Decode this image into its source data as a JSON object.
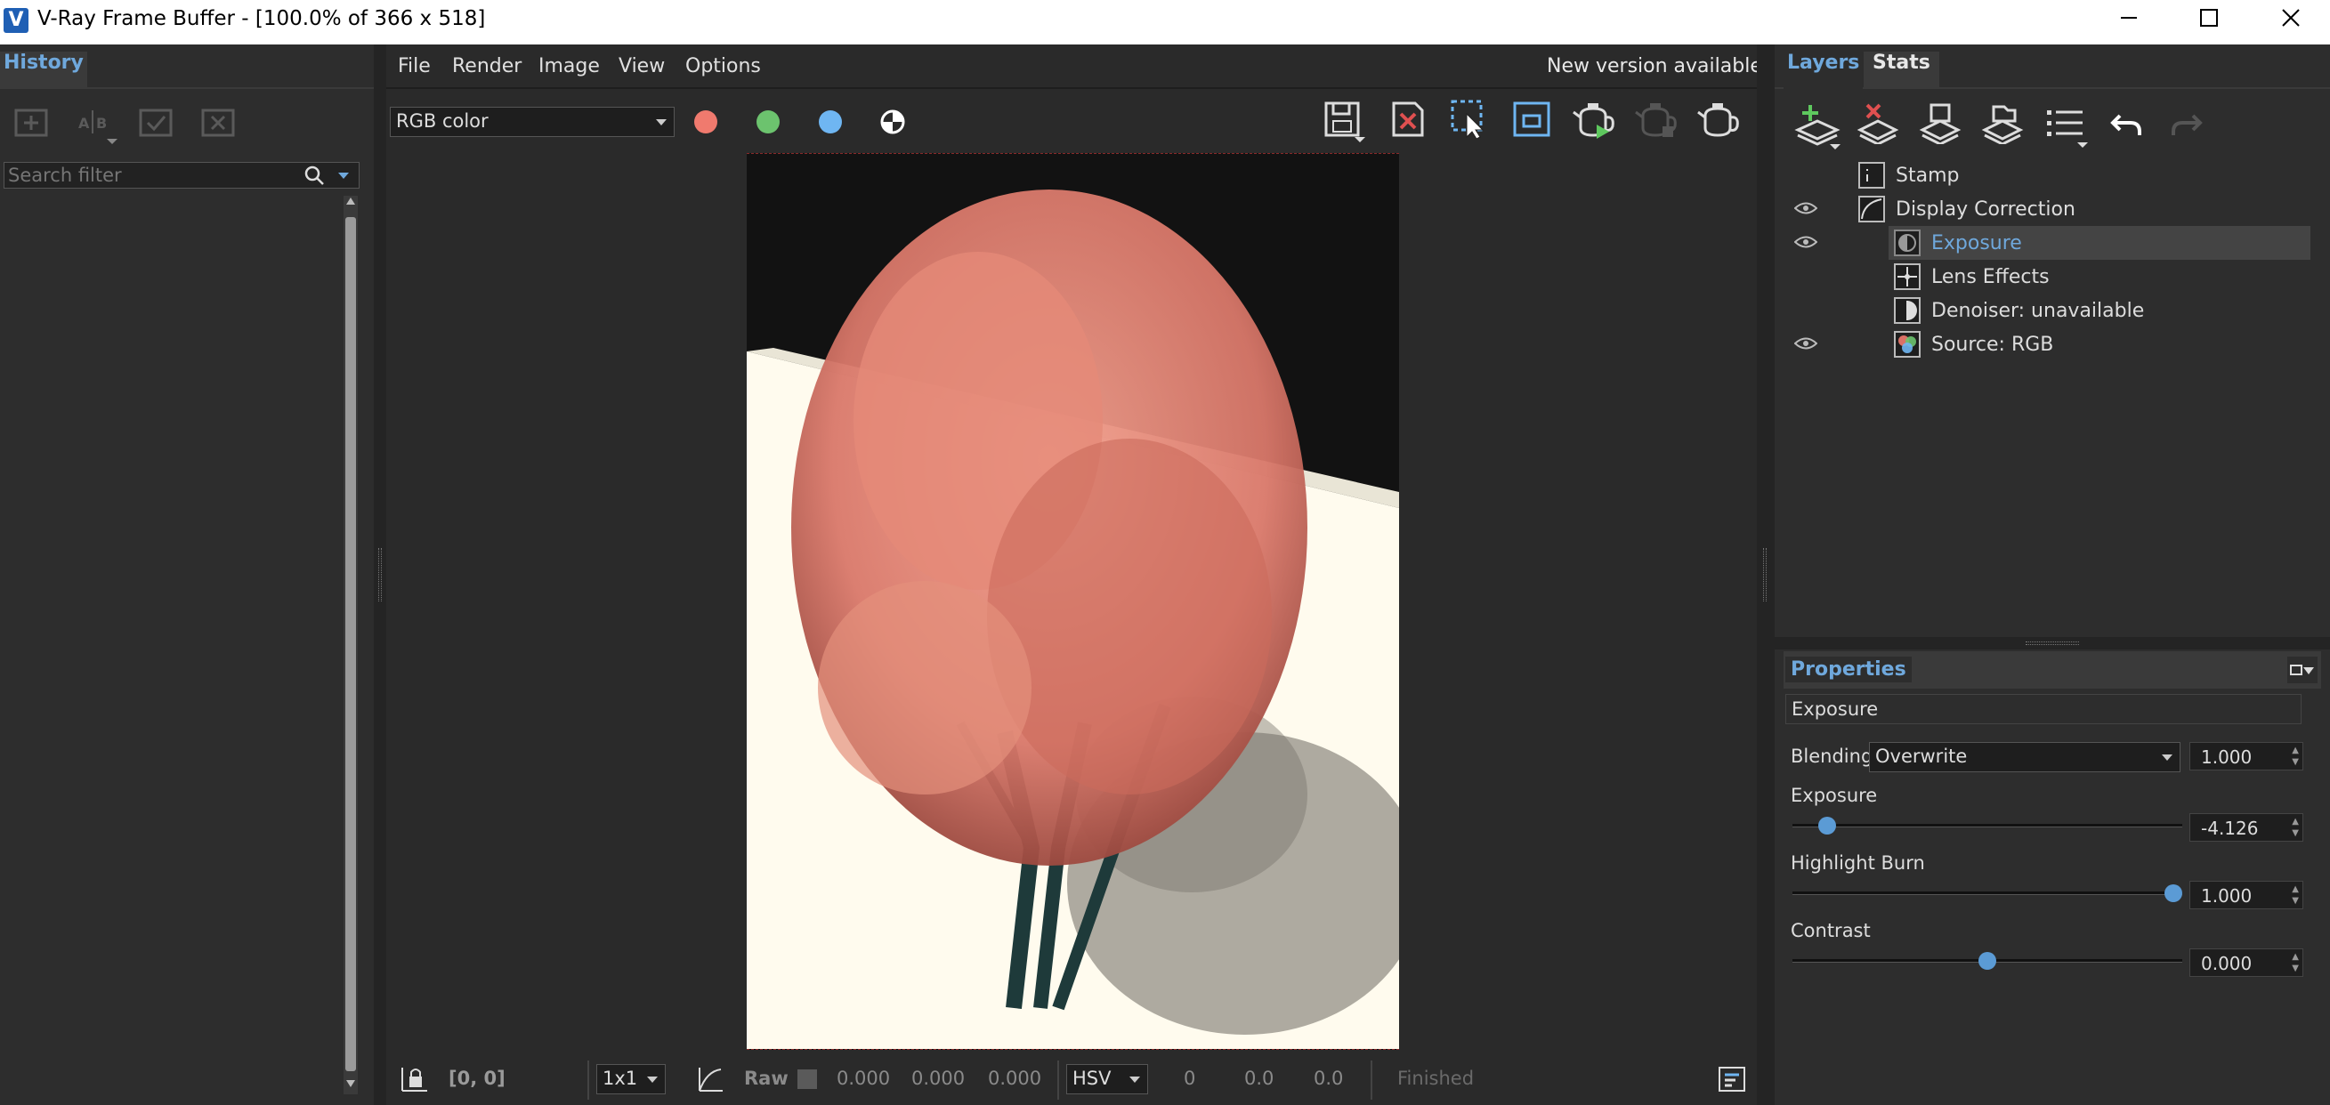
{
  "window": {
    "title": "V-Ray Frame Buffer - [100.0% of 366 x 518]",
    "app_icon_letter": "V"
  },
  "history": {
    "tab_label": "History",
    "search_placeholder": "Search filter"
  },
  "menubar": {
    "items": [
      "File",
      "Render",
      "Image",
      "View",
      "Options"
    ],
    "notice": "New version available!"
  },
  "toolbar": {
    "channel": "RGB color",
    "channel_colors": {
      "red": "#f07a6e",
      "green": "#6cc36e",
      "blue": "#6fb6f2"
    }
  },
  "layers": {
    "tabs": [
      "Layers",
      "Stats"
    ],
    "rows": [
      {
        "name": "Stamp",
        "visible": false,
        "selected": false
      },
      {
        "name": "Display Correction",
        "visible": true,
        "selected": false
      },
      {
        "name": "Exposure",
        "visible": true,
        "selected": true
      },
      {
        "name": "Lens Effects",
        "visible": false,
        "selected": false
      },
      {
        "name": "Denoiser: unavailable",
        "visible": false,
        "selected": false
      },
      {
        "name": "Source: RGB",
        "visible": true,
        "selected": false
      }
    ]
  },
  "properties": {
    "title": "Properties",
    "layer_name": "Exposure",
    "blending_label": "Blending",
    "blending_mode": "Overwrite",
    "blending_value": "1.000",
    "exposure_label": "Exposure",
    "exposure_value": "-4.126",
    "exposure_fraction": 0.07,
    "highlight_label": "Highlight Burn",
    "highlight_value": "1.000",
    "highlight_fraction": 1.0,
    "contrast_label": "Contrast",
    "contrast_value": "0.000",
    "contrast_fraction": 0.5
  },
  "statusbar": {
    "coords": "[0, 0]",
    "ratio": "1x1",
    "raw_label": "Raw",
    "raw_values": [
      "0.000",
      "0.000",
      "0.000"
    ],
    "colorspace": "HSV",
    "hsv_values": [
      "0",
      "0.0",
      "0.0"
    ],
    "state": "Finished"
  },
  "colors": {
    "accent": "#5b9bd5",
    "selected_text": "#6fa8dc",
    "background": "#2b2b2b"
  }
}
